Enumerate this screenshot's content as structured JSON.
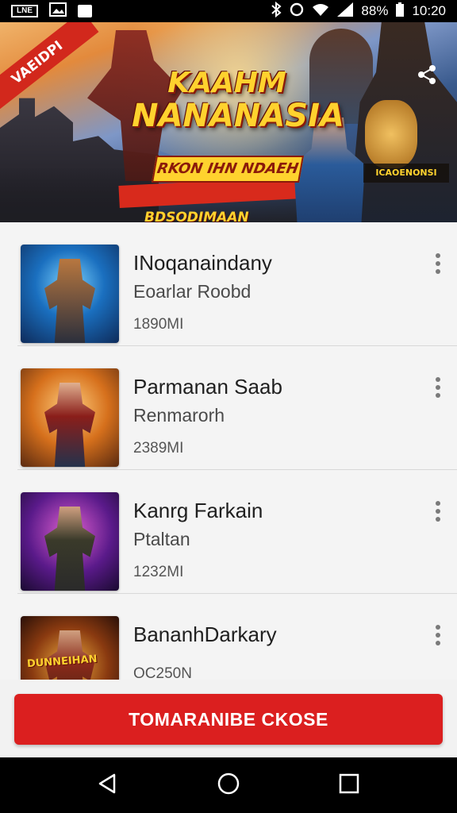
{
  "status_bar": {
    "left_icons": [
      "image-icon",
      "photo-icon",
      "app-icon"
    ],
    "box_icon_label": "LNE",
    "battery_pct": "88%",
    "time": "10:20"
  },
  "banner": {
    "ribbon": "VAEIDPI",
    "title_line1": "KAAHM",
    "title_line2": "NANANASIA",
    "subtitle": "RKON IHN NDAEH",
    "tagline": "BDSODIMAAN",
    "side_label": "ICAOENONSI"
  },
  "list": {
    "items": [
      {
        "title": "INoqanaindany",
        "subtitle": "Eoarlar Roobd",
        "meta": "1890MI"
      },
      {
        "title": "Parmanan Saab",
        "subtitle": "Renmarorh",
        "meta": "2389MI"
      },
      {
        "title": "Kanrg Farkain",
        "subtitle": "Ptaltan",
        "meta": "1232MI"
      },
      {
        "title": "BananhDarkary",
        "subtitle": "",
        "meta": "OC250N"
      }
    ],
    "thumb4_logo": "DUNNEIHAN"
  },
  "cta": {
    "label": "TOMARANIBE CKOSE"
  },
  "colors": {
    "accent": "#db1f1f",
    "banner_gold": "#ffd22e"
  }
}
